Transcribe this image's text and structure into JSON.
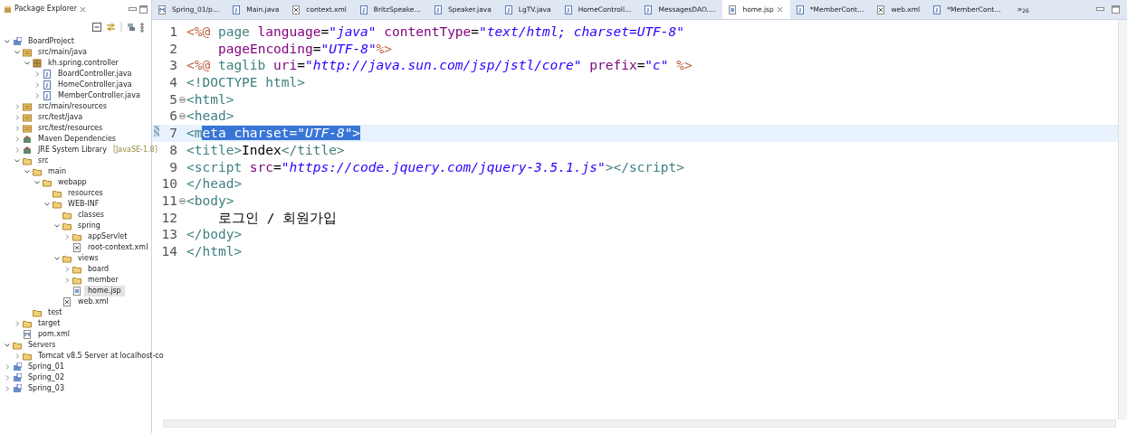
{
  "explorer": {
    "title": "Package Explorer",
    "tree": [
      {
        "label": "BoardProject",
        "kind": "project",
        "expanded": true,
        "selected": false,
        "children": [
          {
            "label": "src/main/java",
            "kind": "srcfolder",
            "expanded": true,
            "selected": false,
            "children": [
              {
                "label": "kh.spring.controller",
                "kind": "package",
                "expanded": true,
                "selected": false,
                "children": [
                  {
                    "label": "BoardController.java",
                    "kind": "java",
                    "expanded": false,
                    "selected": false
                  },
                  {
                    "label": "HomeController.java",
                    "kind": "java",
                    "expanded": false,
                    "selected": false
                  },
                  {
                    "label": "MemberController.java",
                    "kind": "java",
                    "expanded": false,
                    "selected": false
                  }
                ]
              }
            ]
          },
          {
            "label": "src/main/resources",
            "kind": "srcfolder",
            "expanded": false,
            "selected": false
          },
          {
            "label": "src/test/java",
            "kind": "srcfolder",
            "expanded": false,
            "selected": false
          },
          {
            "label": "src/test/resources",
            "kind": "srcfolder",
            "expanded": false,
            "selected": false
          },
          {
            "label": "Maven Dependencies",
            "kind": "library",
            "expanded": false,
            "selected": false
          },
          {
            "label": "JRE System Library",
            "decoration": "[JavaSE-1.8]",
            "kind": "library",
            "expanded": false,
            "selected": false
          },
          {
            "label": "src",
            "kind": "folder",
            "expanded": true,
            "selected": false,
            "children": [
              {
                "label": "main",
                "kind": "folder",
                "expanded": true,
                "selected": false,
                "children": [
                  {
                    "label": "webapp",
                    "kind": "folder",
                    "expanded": true,
                    "selected": false,
                    "children": [
                      {
                        "label": "resources",
                        "kind": "folder",
                        "selected": false
                      },
                      {
                        "label": "WEB-INF",
                        "kind": "folder",
                        "expanded": true,
                        "selected": false,
                        "children": [
                          {
                            "label": "classes",
                            "kind": "folder",
                            "selected": false
                          },
                          {
                            "label": "spring",
                            "kind": "folder",
                            "expanded": true,
                            "selected": false,
                            "children": [
                              {
                                "label": "appServlet",
                                "kind": "folder",
                                "expanded": false,
                                "selected": false
                              },
                              {
                                "label": "root-context.xml",
                                "kind": "xml",
                                "selected": false
                              }
                            ]
                          },
                          {
                            "label": "views",
                            "kind": "folder",
                            "expanded": true,
                            "selected": false,
                            "children": [
                              {
                                "label": "board",
                                "kind": "folder",
                                "expanded": false,
                                "selected": false
                              },
                              {
                                "label": "member",
                                "kind": "folder",
                                "expanded": false,
                                "selected": false
                              },
                              {
                                "label": "home.jsp",
                                "kind": "jsp",
                                "selected": true
                              }
                            ]
                          },
                          {
                            "label": "web.xml",
                            "kind": "xml",
                            "selected": false
                          }
                        ]
                      }
                    ]
                  }
                ]
              },
              {
                "label": "test",
                "kind": "folder",
                "selected": false
              }
            ]
          },
          {
            "label": "target",
            "kind": "folder",
            "expanded": false,
            "selected": false
          },
          {
            "label": "pom.xml",
            "kind": "pom",
            "selected": false
          }
        ]
      },
      {
        "label": "Servers",
        "kind": "folder",
        "expanded": true,
        "selected": false,
        "children": [
          {
            "label": "Tomcat v8.5 Server at localhost-co",
            "kind": "folder",
            "expanded": false,
            "selected": false
          }
        ]
      },
      {
        "label": "Spring_01",
        "kind": "project",
        "expanded": false,
        "selected": false
      },
      {
        "label": "Spring_02",
        "kind": "project",
        "expanded": false,
        "selected": false
      },
      {
        "label": "Spring_03",
        "kind": "project",
        "expanded": false,
        "selected": false
      }
    ]
  },
  "editor": {
    "tabs": [
      {
        "label": "Spring_01/p…",
        "kind": "pom",
        "selected": false
      },
      {
        "label": "Main.java",
        "kind": "java",
        "selected": false
      },
      {
        "label": "context.xml",
        "kind": "xml",
        "selected": false
      },
      {
        "label": "BritzSpeake…",
        "kind": "java",
        "selected": false
      },
      {
        "label": "Speaker.java",
        "kind": "java",
        "selected": false
      },
      {
        "label": "LgTV.java",
        "kind": "java",
        "selected": false
      },
      {
        "label": "HomeControll…",
        "kind": "java",
        "selected": false
      },
      {
        "label": "MessagesDAO.…",
        "kind": "java",
        "selected": false
      },
      {
        "label": "home.jsp",
        "kind": "jsp",
        "selected": true
      },
      {
        "label": "*MemberCont…",
        "kind": "java",
        "selected": false
      },
      {
        "label": "web.xml",
        "kind": "xml",
        "selected": false
      },
      {
        "label": "*MemberCont…",
        "kind": "java",
        "selected": false
      }
    ],
    "overflow": {
      "symbol": "»",
      "count": "26"
    },
    "lines": [
      {
        "number": "1",
        "fold": false,
        "current": false,
        "indent": false,
        "tokens": [
          {
            "kind": "delim",
            "text": "<%@",
            "selected": false
          },
          {
            "kind": "tag",
            "text": " page",
            "selected": false
          },
          {
            "kind": "attr",
            "text": " language",
            "selected": false
          },
          {
            "kind": "plain",
            "text": "=",
            "selected": false
          },
          {
            "kind": "string",
            "text": "\"java\"",
            "selected": false
          },
          {
            "kind": "attr",
            "text": " contentType",
            "selected": false
          },
          {
            "kind": "plain",
            "text": "=",
            "selected": false
          },
          {
            "kind": "string",
            "text": "\"text/html; charset=UTF-8\"",
            "selected": false
          }
        ]
      },
      {
        "number": "2",
        "fold": false,
        "current": false,
        "indent": true,
        "tokens": [
          {
            "kind": "attr",
            "text": "pageEncoding",
            "selected": false
          },
          {
            "kind": "plain",
            "text": "=",
            "selected": false
          },
          {
            "kind": "string",
            "text": "\"UTF-8\"",
            "selected": false
          },
          {
            "kind": "delim",
            "text": "%>",
            "selected": false
          }
        ]
      },
      {
        "number": "3",
        "fold": false,
        "current": false,
        "indent": false,
        "tokens": [
          {
            "kind": "delim",
            "text": "<%@",
            "selected": false
          },
          {
            "kind": "tag",
            "text": " taglib",
            "selected": false
          },
          {
            "kind": "attr",
            "text": " uri",
            "selected": false
          },
          {
            "kind": "plain",
            "text": "=",
            "selected": false
          },
          {
            "kind": "string",
            "text": "\"http://java.sun.com/jsp/jstl/core\"",
            "selected": false
          },
          {
            "kind": "attr",
            "text": " prefix",
            "selected": false
          },
          {
            "kind": "plain",
            "text": "=",
            "selected": false
          },
          {
            "kind": "string",
            "text": "\"c\"",
            "selected": false
          },
          {
            "kind": "delim",
            "text": " %>",
            "selected": false
          }
        ]
      },
      {
        "number": "4",
        "fold": false,
        "current": false,
        "indent": false,
        "tokens": [
          {
            "kind": "tag",
            "text": "<!DOCTYPE html>",
            "selected": false
          }
        ]
      },
      {
        "number": "5",
        "fold": true,
        "current": false,
        "indent": false,
        "tokens": [
          {
            "kind": "tag",
            "text": "<html>",
            "selected": false
          }
        ]
      },
      {
        "number": "6",
        "fold": true,
        "current": false,
        "indent": false,
        "tokens": [
          {
            "kind": "tag",
            "text": "<head>",
            "selected": false
          }
        ]
      },
      {
        "number": "7",
        "fold": false,
        "current": true,
        "indent": false,
        "tokens": [
          {
            "kind": "tag",
            "text": "<m",
            "selected": false
          },
          {
            "kind": "tag",
            "text": "eta",
            "selected": true
          },
          {
            "kind": "attr",
            "text": " charset",
            "selected": true
          },
          {
            "kind": "plain",
            "text": "=",
            "selected": true
          },
          {
            "kind": "string",
            "text": "\"UTF-8\"",
            "selected": true
          },
          {
            "kind": "tag",
            "text": ">",
            "selected": true
          }
        ]
      },
      {
        "number": "8",
        "fold": false,
        "current": false,
        "indent": false,
        "tokens": [
          {
            "kind": "tag",
            "text": "<title>",
            "selected": false
          },
          {
            "kind": "text",
            "text": "Index",
            "selected": false
          },
          {
            "kind": "tag",
            "text": "</title>",
            "selected": false
          }
        ]
      },
      {
        "number": "9",
        "fold": false,
        "current": false,
        "indent": false,
        "tokens": [
          {
            "kind": "tag",
            "text": "<script",
            "selected": false
          },
          {
            "kind": "attr",
            "text": " src",
            "selected": false
          },
          {
            "kind": "plain",
            "text": "=",
            "selected": false
          },
          {
            "kind": "string",
            "text": "\"https://code.jquery.com/jquery-3.5.1.js\"",
            "selected": false
          },
          {
            "kind": "tag",
            "text": "></script>",
            "selected": false
          }
        ]
      },
      {
        "number": "10",
        "fold": false,
        "current": false,
        "indent": false,
        "tokens": [
          {
            "kind": "tag",
            "text": "</head>",
            "selected": false
          }
        ]
      },
      {
        "number": "11",
        "fold": true,
        "current": false,
        "indent": false,
        "tokens": [
          {
            "kind": "tag",
            "text": "<body>",
            "selected": false
          }
        ]
      },
      {
        "number": "12",
        "fold": false,
        "current": false,
        "indent": true,
        "tokens": [
          {
            "kind": "text",
            "text": "로그인 / 회원가입",
            "selected": false
          }
        ]
      },
      {
        "number": "13",
        "fold": false,
        "current": false,
        "indent": false,
        "tokens": [
          {
            "kind": "tag",
            "text": "</body>",
            "selected": false
          }
        ]
      },
      {
        "number": "14",
        "fold": false,
        "current": false,
        "indent": false,
        "tokens": [
          {
            "kind": "tag",
            "text": "</html>",
            "selected": false
          }
        ]
      }
    ]
  }
}
